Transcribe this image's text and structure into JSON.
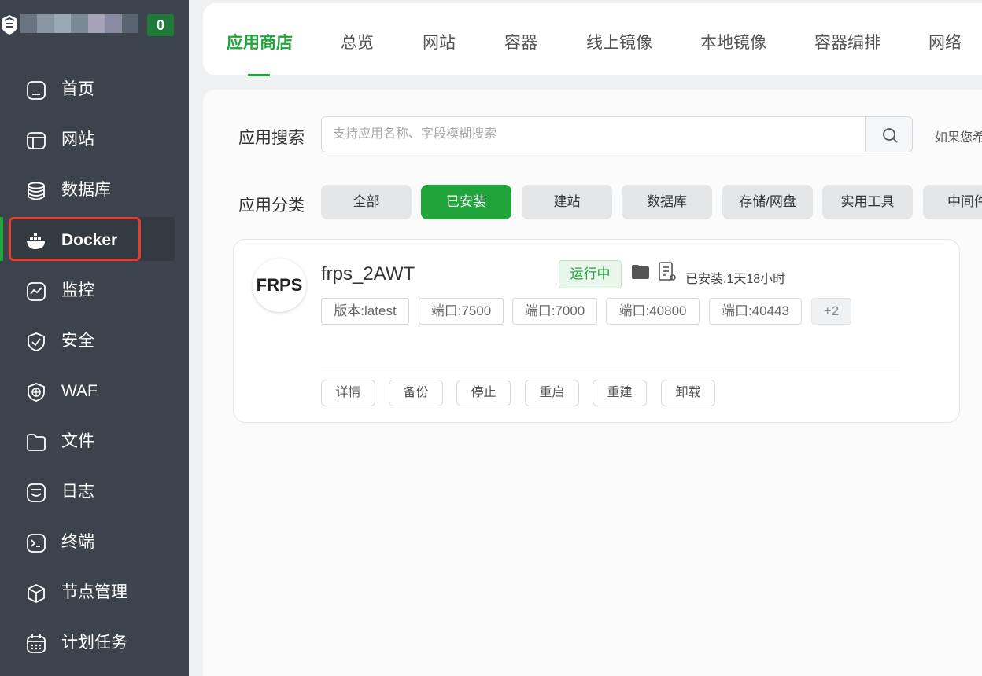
{
  "header": {
    "message_count": "0"
  },
  "sidebar": {
    "items": [
      {
        "label": "首页",
        "icon": "home-icon"
      },
      {
        "label": "网站",
        "icon": "website-icon"
      },
      {
        "label": "数据库",
        "icon": "database-icon"
      },
      {
        "label": "Docker",
        "icon": "docker-icon",
        "active": true
      },
      {
        "label": "监控",
        "icon": "monitor-icon"
      },
      {
        "label": "安全",
        "icon": "shield-icon"
      },
      {
        "label": "WAF",
        "icon": "waf-icon"
      },
      {
        "label": "文件",
        "icon": "folder-icon"
      },
      {
        "label": "日志",
        "icon": "log-icon"
      },
      {
        "label": "终端",
        "icon": "terminal-icon"
      },
      {
        "label": "节点管理",
        "icon": "cube-icon"
      },
      {
        "label": "计划任务",
        "icon": "calendar-icon"
      }
    ]
  },
  "tabs": [
    {
      "label": "应用商店",
      "active": true
    },
    {
      "label": "总览"
    },
    {
      "label": "网站"
    },
    {
      "label": "容器"
    },
    {
      "label": "线上镜像"
    },
    {
      "label": "本地镜像"
    },
    {
      "label": "容器编排"
    },
    {
      "label": "网络"
    }
  ],
  "search": {
    "label": "应用搜索",
    "placeholder": "支持应用名称、字段模糊搜索",
    "value": "",
    "hint": "如果您希"
  },
  "categories": {
    "label": "应用分类",
    "items": [
      {
        "label": "全部"
      },
      {
        "label": "已安装",
        "active": true
      },
      {
        "label": "建站"
      },
      {
        "label": "数据库"
      },
      {
        "label": "存储/网盘"
      },
      {
        "label": "实用工具"
      },
      {
        "label": "中间件"
      }
    ]
  },
  "app": {
    "logo_text": "FRPS",
    "name": "frps_2AWT",
    "status": "运行中",
    "installed": "已安装:1天18小时",
    "tags": [
      "版本:latest",
      "端口:7500",
      "端口:7000",
      "端口:40800",
      "端口:40443",
      "+2"
    ],
    "actions": [
      "详情",
      "备份",
      "停止",
      "重启",
      "重建",
      "卸载"
    ]
  },
  "colors": {
    "accent": "#20a53a",
    "sidebar_bg": "#3c434c",
    "highlight": "#e0402f"
  }
}
